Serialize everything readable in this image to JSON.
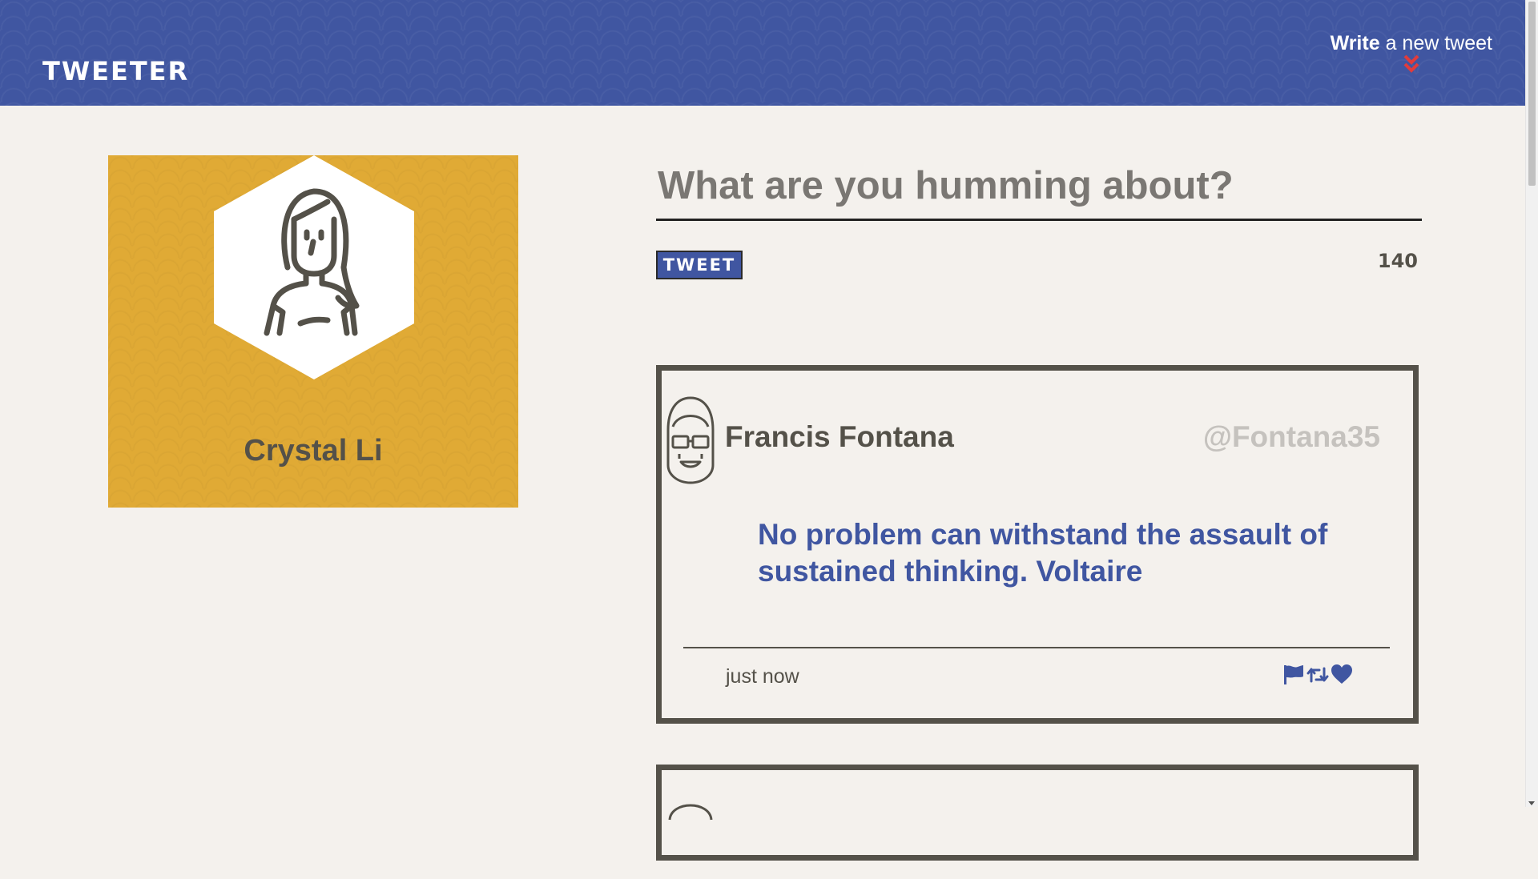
{
  "header": {
    "brand": "TWEETER",
    "compose_bold": "Write",
    "compose_rest": "a new tweet",
    "toggle_icon": "double-chevron-down-icon"
  },
  "colors": {
    "brand_blue": "#4056a1",
    "card_gold": "#e0aa35",
    "page_bg": "#f4f1ed",
    "text_dark": "#545149",
    "accent_red": "#e23b3b",
    "handle_gray": "#c5c2be"
  },
  "profile": {
    "name": "Crystal Li",
    "avatar_icon": "woman-avatar-icon"
  },
  "composer": {
    "placeholder": "What are you humming about?",
    "submit_label": "TWEET",
    "char_count": "140"
  },
  "tweets": [
    {
      "author": "Francis Fontana",
      "handle": "@Fontana35",
      "text": "No problem can withstand the assault of sustained thinking. Voltaire",
      "time": "just now",
      "avatar_icon": "man-avatar-icon",
      "actions": [
        "flag-icon",
        "retweet-icon",
        "heart-icon"
      ]
    }
  ]
}
